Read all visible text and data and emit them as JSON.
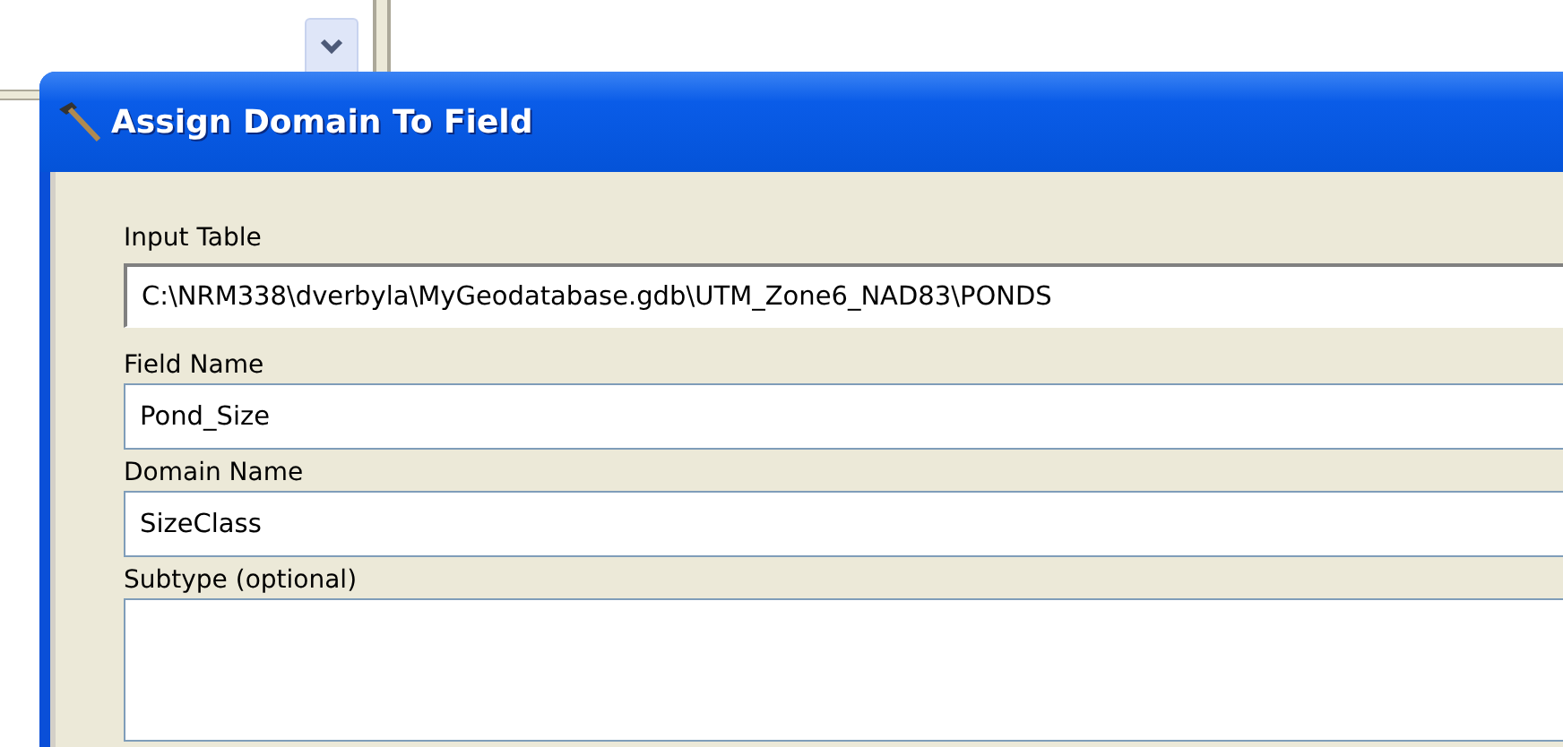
{
  "window": {
    "title": "Assign Domain To Field"
  },
  "fields": [
    {
      "label": "Input Table",
      "value": "C:\\NRM338\\dverbyla\\MyGeodatabase.gdb\\UTM_Zone6_NAD83\\PONDS",
      "kind": "sunken"
    },
    {
      "label": "Field Name",
      "value": "Pond_Size",
      "kind": "plain"
    },
    {
      "label": "Domain Name",
      "value": "SizeClass",
      "kind": "plain"
    },
    {
      "label": "Subtype (optional)",
      "kind": "list"
    }
  ]
}
